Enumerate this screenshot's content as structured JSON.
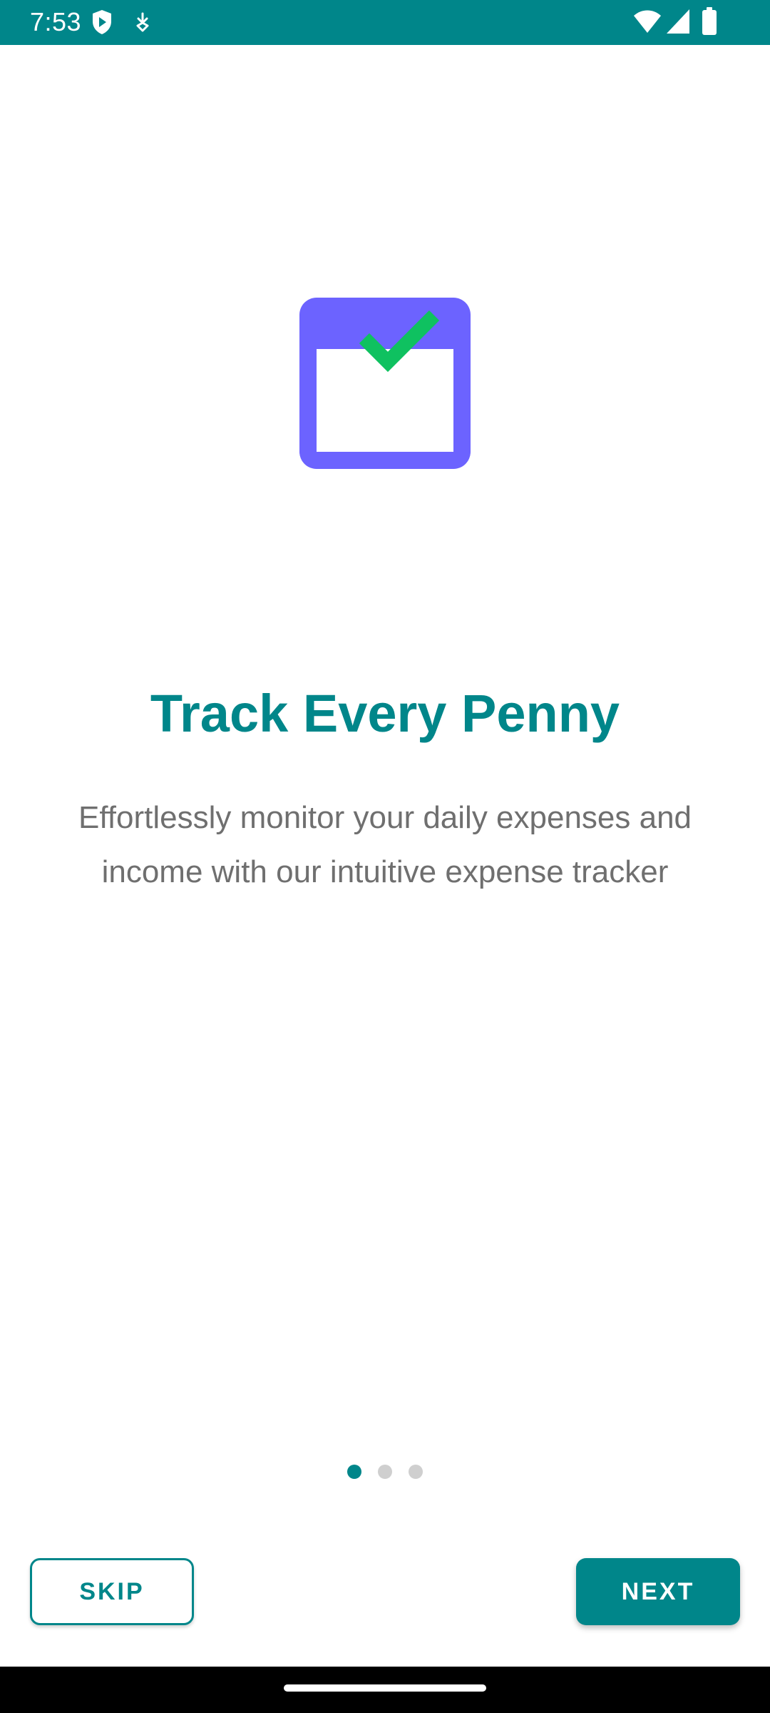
{
  "status_bar": {
    "time": "7:53",
    "icons": [
      "shield-play-icon",
      "download-status-icon",
      "wifi-icon",
      "cellular-signal-icon",
      "battery-icon"
    ],
    "background": "#00868a"
  },
  "onboarding": {
    "illustration": "calendar-check-icon",
    "illustration_colors": {
      "frame": "#6c63ff",
      "check": "#0fc160"
    },
    "title": "Track Every Penny",
    "description": "Effortlessly monitor your daily expenses and income with our intuitive expense tracker",
    "pages": {
      "total": 3,
      "current": 1
    }
  },
  "actions": {
    "skip_label": "SKIP",
    "next_label": "NEXT"
  },
  "colors": {
    "accent": "#00868a",
    "subtitle": "#6f6f6f",
    "dot_inactive": "#cfcfcf"
  }
}
